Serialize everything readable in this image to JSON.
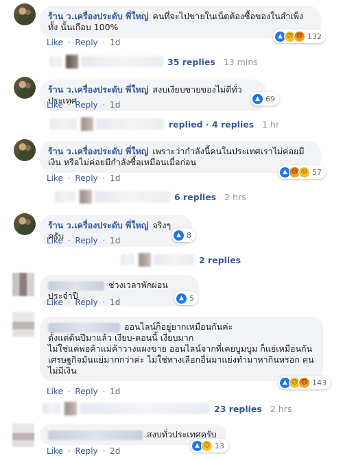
{
  "shop_name": "ร้าน ว.เครื่องประดับ พี่ใหญ่",
  "actions": {
    "like": "Like",
    "reply": "Reply",
    "dot": "·"
  },
  "comments": [
    {
      "text": "คนที่จะไปขายในเน็ตต้องซื้อของในสำเพ็งทั้ง นั้นเกือบ 100%",
      "time": "1d",
      "reactions": [
        "like-icon",
        "sad-icon",
        "angry-icon"
      ],
      "reaction_count": "132",
      "replies_label": "35 replies",
      "replies_time": "13 mins"
    },
    {
      "text": "สงบเงียบขายของไม่ดีทั่วประเทศ",
      "time": "1d",
      "reactions": [
        "like-icon"
      ],
      "reaction_count": "69",
      "replies_label": "replied · 4 replies",
      "replies_time": "1 hr"
    },
    {
      "text": "เพราะว่ากำลังนี้คนในประเทศเราไม่ค่อยมีเงิน หรือไม่ค่อยมีกำลังซื้อเหมือนเมื่อก่อน",
      "time": "1d",
      "reactions": [
        "like-icon",
        "angry-icon",
        "sad-icon"
      ],
      "reaction_count": "57",
      "replies_label": "6 replies",
      "replies_time": "2 hrs"
    },
    {
      "text": "จริงๆครับ",
      "time": "1d",
      "reactions": [
        "like-icon"
      ],
      "reaction_count": "8",
      "replies_label": "2 replies",
      "replies_time": ""
    },
    {
      "text": "ช่วงเวลาพักผ่อนประจำปี",
      "time": "1d",
      "reactions": [
        "like-icon"
      ],
      "reaction_count": "5"
    },
    {
      "lines": [
        "ออนไลน์ก็อยู่ยากเหมือนกันค่ะ",
        "ตั้งแต่ต้นปีมาแล้ว เงียบ-ตอนนี้ เงียบมาก",
        "ไม่ใช่แค่พ่อค้าแม่ค้าวางแผงขาย ออนไลน์จากที่เคยบูมบูม ก็แย่เหมือนกัน",
        "เศรษฐกิจมันแย่มากกว่าค่ะ ไม่ใช่ทางเลือกอื่นมาแย่งทำมาหากินหรอก คน",
        "ไม่มีเงิน"
      ],
      "time": "1d",
      "reactions": [
        "like-icon",
        "sad-icon",
        "angry-icon"
      ],
      "reaction_count": "143",
      "replies_label": "23 replies",
      "replies_time": "2 hrs"
    },
    {
      "text": "สงบทั่วประเทศครับ",
      "time": "2d",
      "reactions": [
        "like-icon",
        "haha-icon"
      ],
      "reaction_count": "13"
    }
  ]
}
